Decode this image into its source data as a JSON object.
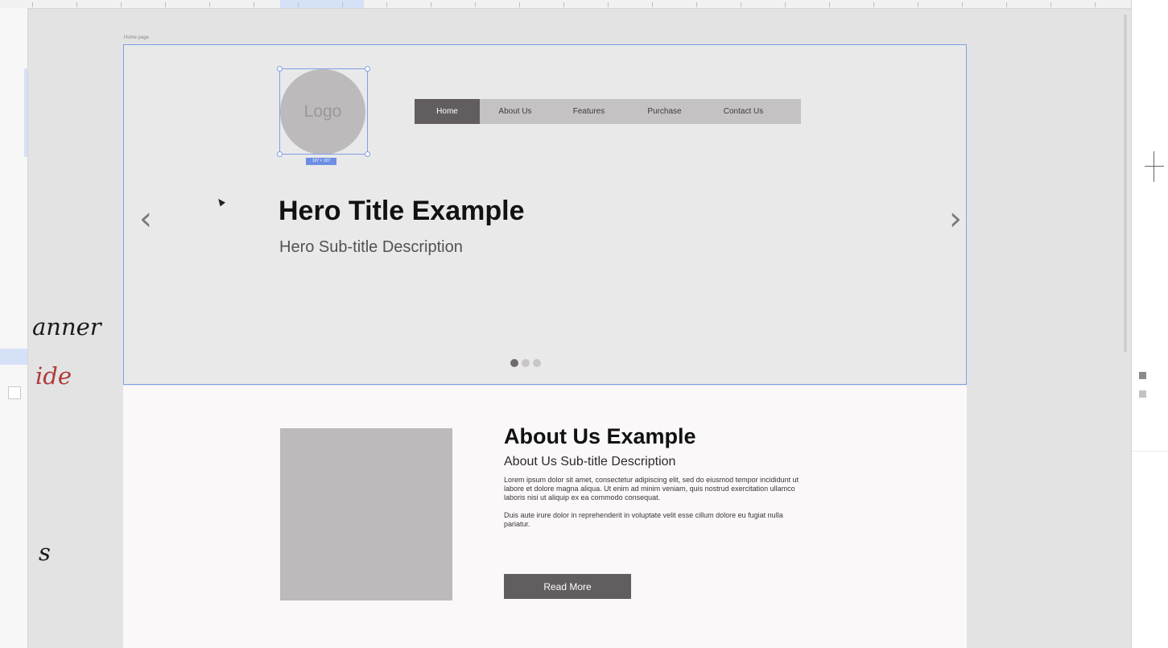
{
  "annotations": {
    "banner": "anner",
    "slide": "ide",
    "s": "s"
  },
  "artboard": {
    "label": "Home page"
  },
  "hero": {
    "logo_text": "Logo",
    "selection_size": "107 × 107",
    "nav": [
      {
        "label": "Home",
        "active": true
      },
      {
        "label": "About Us",
        "active": false
      },
      {
        "label": "Features",
        "active": false
      },
      {
        "label": "Purchase",
        "active": false
      },
      {
        "label": "Contact Us",
        "active": false
      }
    ],
    "nav_labels": {
      "home": "Home",
      "about": "About Us",
      "features": "Features",
      "purchase": "Purchase",
      "contact": "Contact Us"
    },
    "title": "Hero Title Example",
    "subtitle": "Hero Sub-title Description",
    "prev_icon": "‹",
    "next_icon": "›",
    "dots": {
      "count": 3,
      "active_index": 0
    }
  },
  "about": {
    "title": "About Us Example",
    "subtitle": "About Us Sub-title Description",
    "paragraph1": "Lorem ipsum dolor sit amet, consectetur adipiscing elit, sed do eiusmod tempor incididunt ut labore et dolore magna aliqua. Ut enim ad minim veniam, quis nostrud exercitation ullamco laboris nisi ut aliquip ex ea commodo consequat.",
    "paragraph2": "Duis aute irure dolor in reprehenderit in voluptate velit esse cillum dolore eu fugiat nulla pariatur.",
    "button": "Read More"
  },
  "colors": {
    "selection_blue": "#7f9fe6",
    "nav_active": "#625d5e",
    "placeholder_gray": "#bdbabb",
    "annotation_red": "#c0392b",
    "annotation_black": "#1a1a1a"
  }
}
